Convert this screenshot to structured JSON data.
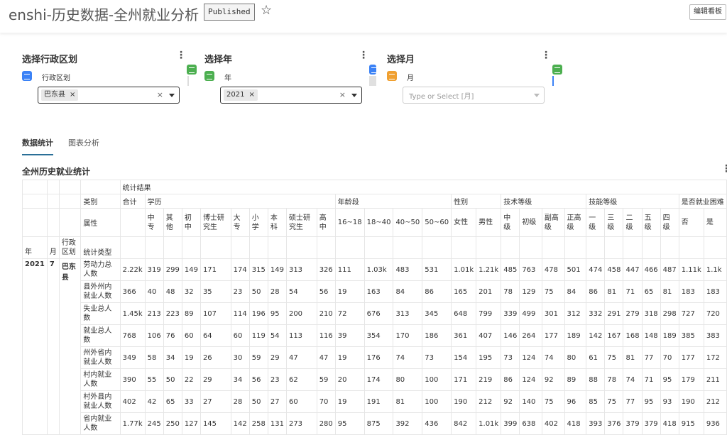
{
  "header": {
    "title": "enshi-历史数据-全州就业分析",
    "published": "Published",
    "edit_label": "编辑看板"
  },
  "filters": [
    {
      "title": "选择行政区划",
      "label": "行政区划",
      "chip": "巴东县",
      "icon_color": "#3b82f6",
      "placeholder": ""
    },
    {
      "title": "选择年",
      "label": "年",
      "chip": "2021",
      "icon_color": "#4caf50",
      "placeholder": ""
    },
    {
      "title": "选择月",
      "label": "月",
      "chip": "",
      "icon_color": "#f0a030",
      "placeholder": "Type or Select [月]"
    }
  ],
  "tabs": [
    "数据统计",
    "图表分析"
  ],
  "table_title": "全州历史就业统计",
  "table": {
    "result_header": "统计结果",
    "category_label": "类别",
    "attribute_label": "属性",
    "type_label": "统计类型",
    "groups": [
      "合计",
      "学历",
      "年龄段",
      "性别",
      "技术等级",
      "技能等级",
      "是否就业困难"
    ],
    "edu": [
      "中专",
      "其他",
      "初中",
      "博士研究生",
      "大专",
      "小学",
      "本科",
      "硕士研究生",
      "高中"
    ],
    "age": [
      "16~18",
      "18~40",
      "40~50",
      "50~60"
    ],
    "gender": [
      "女性",
      "男性"
    ],
    "tech": [
      "中级",
      "初级",
      "副高级",
      "正高级"
    ],
    "skill": [
      "一级",
      "三级",
      "二级",
      "五级",
      "四级"
    ],
    "difficulty": [
      "否",
      "是"
    ],
    "dims": [
      "年",
      "月",
      "行政区划"
    ],
    "dim_values": [
      "2021",
      "7",
      "巴东县"
    ],
    "rows": [
      {
        "name": "劳动力总人数",
        "vals": [
          "2.22k",
          "319",
          "299",
          "149",
          "171",
          "174",
          "315",
          "149",
          "313",
          "326",
          "111",
          "1.03k",
          "483",
          "531",
          "1.01k",
          "1.21k",
          "485",
          "763",
          "478",
          "501",
          "474",
          "458",
          "447",
          "466",
          "487",
          "1.11k",
          "1.1k"
        ]
      },
      {
        "name": "县外州内就业人数",
        "vals": [
          "366",
          "40",
          "48",
          "32",
          "35",
          "23",
          "50",
          "28",
          "54",
          "56",
          "19",
          "163",
          "84",
          "86",
          "165",
          "201",
          "78",
          "129",
          "75",
          "84",
          "86",
          "81",
          "71",
          "65",
          "81",
          "183",
          "183"
        ]
      },
      {
        "name": "失业总人数",
        "vals": [
          "1.45k",
          "213",
          "223",
          "89",
          "107",
          "114",
          "196",
          "95",
          "200",
          "210",
          "72",
          "676",
          "313",
          "345",
          "648",
          "799",
          "339",
          "499",
          "301",
          "312",
          "332",
          "291",
          "279",
          "318",
          "298",
          "727",
          "720"
        ]
      },
      {
        "name": "就业总人数",
        "vals": [
          "768",
          "106",
          "76",
          "60",
          "64",
          "60",
          "119",
          "54",
          "113",
          "116",
          "39",
          "354",
          "170",
          "186",
          "361",
          "407",
          "146",
          "264",
          "177",
          "189",
          "142",
          "167",
          "168",
          "148",
          "189",
          "385",
          "383"
        ]
      },
      {
        "name": "州外省内就业人数",
        "vals": [
          "349",
          "58",
          "34",
          "19",
          "26",
          "30",
          "59",
          "29",
          "47",
          "47",
          "19",
          "176",
          "74",
          "73",
          "154",
          "195",
          "73",
          "124",
          "74",
          "80",
          "61",
          "75",
          "81",
          "77",
          "70",
          "177",
          "172"
        ]
      },
      {
        "name": "村内就业人数",
        "vals": [
          "390",
          "55",
          "50",
          "22",
          "29",
          "34",
          "56",
          "23",
          "62",
          "59",
          "20",
          "174",
          "80",
          "100",
          "171",
          "219",
          "86",
          "124",
          "92",
          "89",
          "88",
          "78",
          "74",
          "71",
          "95",
          "179",
          "211"
        ]
      },
      {
        "name": "村外县内就业人数",
        "vals": [
          "402",
          "42",
          "65",
          "33",
          "27",
          "28",
          "50",
          "27",
          "60",
          "70",
          "19",
          "191",
          "81",
          "100",
          "190",
          "212",
          "92",
          "140",
          "75",
          "96",
          "85",
          "75",
          "77",
          "95",
          "93",
          "190",
          "212"
        ]
      },
      {
        "name": "省内就业人数",
        "vals": [
          "1.77k",
          "245",
          "250",
          "127",
          "145",
          "142",
          "258",
          "131",
          "273",
          "280",
          "95",
          "875",
          "392",
          "436",
          "842",
          "1.01k",
          "399",
          "638",
          "402",
          "418",
          "393",
          "376",
          "379",
          "379",
          "418",
          "915",
          "936"
        ]
      }
    ]
  }
}
